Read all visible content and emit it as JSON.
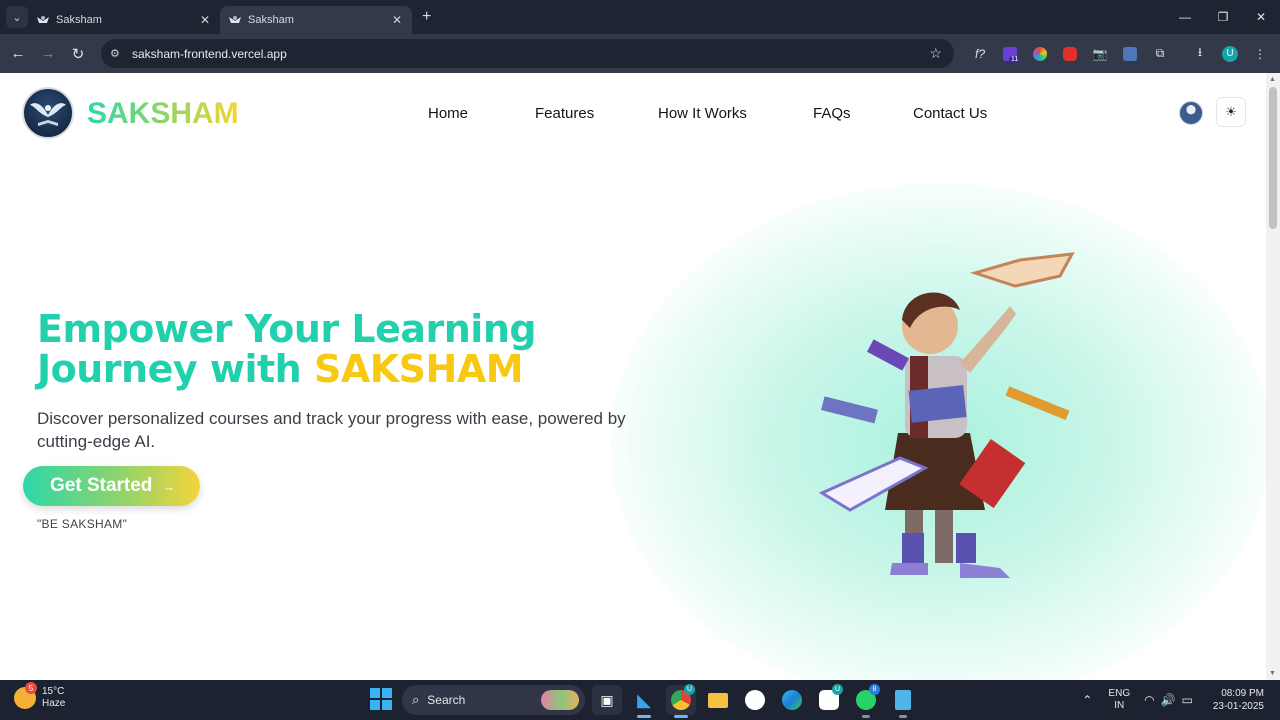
{
  "browser": {
    "tabs": [
      {
        "title": "Saksham",
        "active": false
      },
      {
        "title": "Saksham",
        "active": true
      }
    ],
    "url": "saksham-frontend.vercel.app",
    "profile_initial": "U",
    "ext_badge": "11"
  },
  "site": {
    "brand": "SAKSHAM",
    "nav": [
      "Home",
      "Features",
      "How It Works",
      "FAQs",
      "Contact Us"
    ],
    "hero": {
      "title_part1": "Empower Your Learning",
      "title_part2": "Journey with ",
      "title_highlight": "SAKSHAM",
      "description": "Discover personalized courses and track your progress with ease, powered by cutting-edge AI.",
      "cta_label": "Get Started",
      "tagline": "\"BE SAKSHAM\""
    },
    "colors": {
      "accent_teal": "#22d0ae",
      "accent_yellow": "#f7c912"
    }
  },
  "taskbar": {
    "weather": {
      "temp": "15°C",
      "condition": "Haze",
      "badge": "5"
    },
    "search_label": "Search",
    "chrome_badge": "U",
    "whatsapp_badge": "8",
    "ai_badge": "U",
    "lang_top": "ENG",
    "lang_bottom": "IN",
    "time": "08:09 PM",
    "date": "23-01-2025"
  }
}
